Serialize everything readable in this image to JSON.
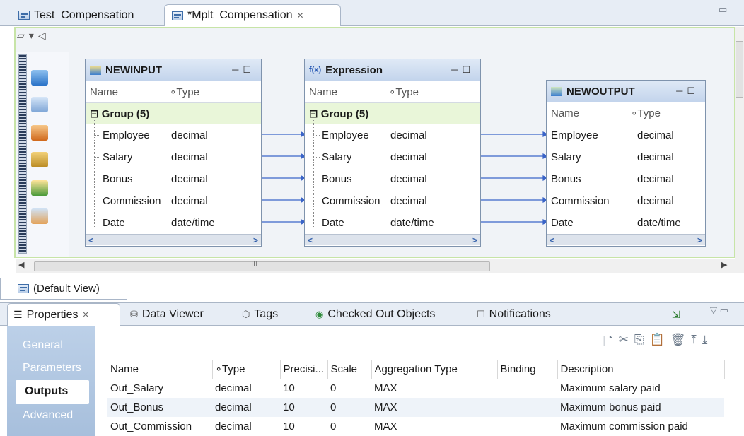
{
  "editor_tabs": [
    {
      "label": "Test_Compensation",
      "active": false
    },
    {
      "label": "*Mplt_Compensation",
      "active": true,
      "close": "✕"
    }
  ],
  "canvas": {
    "boxes": [
      {
        "title": "NEWINPUT",
        "col_name": "Name",
        "col_type": "Type",
        "group": "Group (5)",
        "rows": [
          {
            "name": "Employee",
            "type": "decimal"
          },
          {
            "name": "Salary",
            "type": "decimal"
          },
          {
            "name": "Bonus",
            "type": "decimal"
          },
          {
            "name": "Commission",
            "type": "decimal"
          },
          {
            "name": "Date",
            "type": "date/time"
          }
        ]
      },
      {
        "title": "Expression",
        "col_name": "Name",
        "col_type": "Type",
        "group": "Group (5)",
        "rows": [
          {
            "name": "Employee",
            "type": "decimal"
          },
          {
            "name": "Salary",
            "type": "decimal"
          },
          {
            "name": "Bonus",
            "type": "decimal"
          },
          {
            "name": "Commission",
            "type": "decimal"
          },
          {
            "name": "Date",
            "type": "date/time"
          }
        ]
      },
      {
        "title": "NEWOUTPUT",
        "col_name": "Name",
        "col_type": "Type",
        "rows": [
          {
            "name": "Employee",
            "type": "decimal"
          },
          {
            "name": "Salary",
            "type": "decimal"
          },
          {
            "name": "Bonus",
            "type": "decimal"
          },
          {
            "name": "Commission",
            "type": "decimal"
          },
          {
            "name": "Date",
            "type": "date/time"
          }
        ]
      }
    ],
    "scroll_mid": "III",
    "default_view": "(Default View)"
  },
  "panel_tabs": [
    {
      "label": "Properties",
      "active": true,
      "close": "✕"
    },
    {
      "label": "Data Viewer"
    },
    {
      "label": "Tags"
    },
    {
      "label": "Checked Out Objects"
    },
    {
      "label": "Notifications"
    }
  ],
  "nav": [
    "General",
    "Parameters",
    "Outputs",
    "Advanced"
  ],
  "nav_selected": "Outputs",
  "outputs_table": {
    "headers": [
      "Name",
      "Type",
      "Precisi...",
      "Scale",
      "Aggregation Type",
      "Binding",
      "Description"
    ],
    "rows": [
      [
        "Out_Salary",
        "decimal",
        "10",
        "0",
        "MAX",
        "",
        "Maximum salary paid"
      ],
      [
        "Out_Bonus",
        "decimal",
        "10",
        "0",
        "MAX",
        "",
        "Maximum bonus paid"
      ],
      [
        "Out_Commission",
        "decimal",
        "10",
        "0",
        "MAX",
        "",
        "Maximum commission paid"
      ]
    ]
  },
  "icons": [
    "new-icon",
    "cut-icon",
    "copy-icon",
    "paste-icon",
    "delete-icon",
    "move-up-icon",
    "move-down-icon"
  ]
}
